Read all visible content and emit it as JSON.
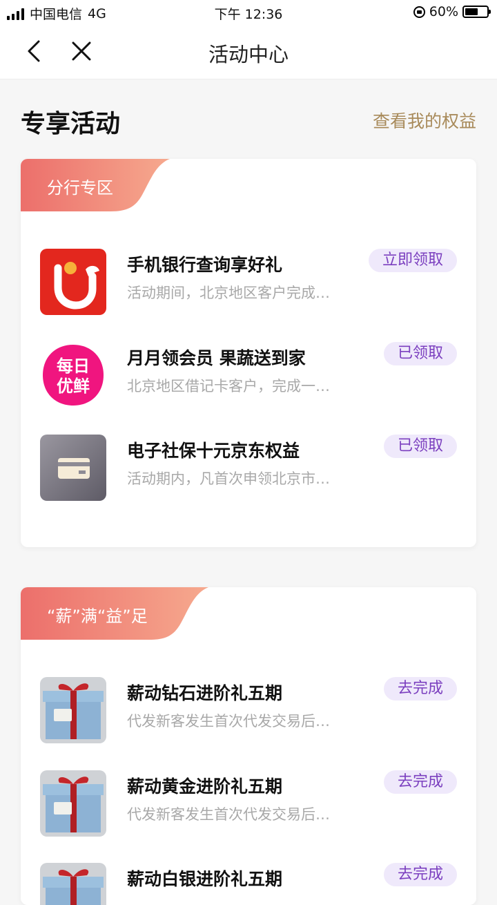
{
  "status_bar": {
    "carrier": "中国电信",
    "network": "4G",
    "time": "下午 12:36",
    "battery": "60%",
    "battery_level": 0.6
  },
  "nav": {
    "title": "活动中心",
    "back_icon": "chevron-left-icon",
    "close_icon": "close-icon"
  },
  "header": {
    "title": "专享活动",
    "link": "查看我的权益"
  },
  "colors": {
    "link_gold": "#a88a5a",
    "tag_start": "#ec6f6b",
    "tag_end": "#f6a98e",
    "button_bg": "#efe9fb",
    "button_text": "#7b3fbf"
  },
  "cards": [
    {
      "tag": "分行专区",
      "items": [
        {
          "icon": "app-logo-icon",
          "title": "手机银行查询享好礼",
          "desc": "活动期间，北京地区客户完成…",
          "action": "立即领取"
        },
        {
          "icon": "meiri-youxian-logo-icon",
          "logo_text_top": "每日",
          "logo_text_bottom": "优鲜",
          "title": "月月领会员 果蔬送到家",
          "desc": "北京地区借记卡客户，完成一…",
          "action": "已领取"
        },
        {
          "icon": "card-icon",
          "title": "电子社保十元京东权益",
          "desc": "活动期内，凡首次申领北京市…",
          "action": "已领取"
        }
      ]
    },
    {
      "tag": "“薪”满“益”足",
      "items": [
        {
          "icon": "gift-box-icon",
          "title": "薪动钻石进阶礼五期",
          "desc": "代发新客发生首次代发交易后…",
          "action": "去完成"
        },
        {
          "icon": "gift-box-icon",
          "title": "薪动黄金进阶礼五期",
          "desc": "代发新客发生首次代发交易后…",
          "action": "去完成"
        },
        {
          "icon": "gift-box-icon",
          "title": "薪动白银进阶礼五期",
          "desc": "",
          "action": "去完成"
        }
      ]
    }
  ]
}
